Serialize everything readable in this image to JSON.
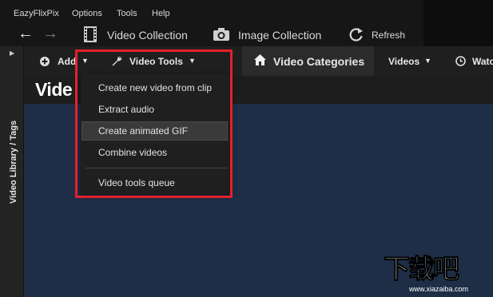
{
  "menubar": {
    "app_name": "EazyFlixPix",
    "items": [
      "Options",
      "Tools",
      "Help"
    ]
  },
  "toolbar": {
    "back_label": "←",
    "forward_label": "→",
    "video_collection_label": "Video Collection",
    "image_collection_label": "Image Collection",
    "refresh_label": "Refresh"
  },
  "side_panel": {
    "label": "Video Library / Tags",
    "chevron": "▶"
  },
  "tabs": {
    "add_label": "Add",
    "video_tools_label": "Video Tools",
    "video_categories_label": "Video Categories",
    "videos_label": "Videos",
    "watch_label": "Watc",
    "caret": "▼"
  },
  "main": {
    "title": "Vide"
  },
  "dropdown": {
    "items": [
      "Create new video from clip",
      "Extract audio",
      "Create animated GIF",
      "Combine videos",
      "Video tools queue"
    ],
    "hovered_index": 2
  },
  "watermark": {
    "text": "下载吧",
    "url": "www.xiazaiba.com"
  },
  "colors": {
    "highlight": "#e5202b",
    "content_bg": "#1e2e46",
    "chrome_bg": "#161616"
  }
}
